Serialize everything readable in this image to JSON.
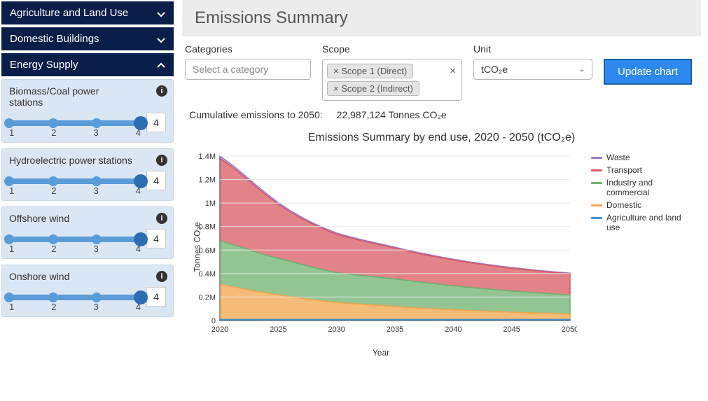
{
  "sidebar": {
    "sections": [
      {
        "title": "Agriculture and Land Use",
        "expanded": false
      },
      {
        "title": "Domestic Buildings",
        "expanded": false
      },
      {
        "title": "Energy Supply",
        "expanded": true
      }
    ],
    "sliders": [
      {
        "label": "Biomass/Coal power stations",
        "value": "4",
        "ticks": [
          "1",
          "2",
          "3",
          "4"
        ]
      },
      {
        "label": "Hydroelectric power stations",
        "value": "4",
        "ticks": [
          "1",
          "2",
          "3",
          "4"
        ]
      },
      {
        "label": "Offshore wind",
        "value": "4",
        "ticks": [
          "1",
          "2",
          "3",
          "4"
        ]
      },
      {
        "label": "Onshore wind",
        "value": "4",
        "ticks": [
          "1",
          "2",
          "3",
          "4"
        ]
      }
    ]
  },
  "header": {
    "title": "Emissions Summary"
  },
  "filters": {
    "categories_label": "Categories",
    "categories_placeholder": "Select a category",
    "scope_label": "Scope",
    "scope_chips": [
      "Scope 1 (Direct)",
      "Scope 2 (Indirect)"
    ],
    "scope_clear": "×",
    "unit_label": "Unit",
    "unit_value": "tCO₂e",
    "update_label": "Update chart"
  },
  "cumulative": {
    "label": "Cumulative emissions to 2050:",
    "value": "22,987,124 Tonnes CO₂e"
  },
  "chart_title": "Emissions Summary by end use, 2020 - 2050 (tCO₂e)",
  "axes": {
    "y": "Tonnes CO₂e",
    "x": "Year"
  },
  "yticks": [
    "0",
    "0.2M",
    "0.4M",
    "0.6M",
    "0.8M",
    "1M",
    "1.2M",
    "1.4M"
  ],
  "xticks": [
    "2020",
    "2025",
    "2030",
    "2035",
    "2040",
    "2045",
    "2050"
  ],
  "legend": [
    {
      "name": "Waste",
      "color": "#9e7cc1"
    },
    {
      "name": "Transport",
      "color": "#d85a63"
    },
    {
      "name": "Industry and commercial",
      "color": "#6fb26f"
    },
    {
      "name": "Domestic",
      "color": "#f2a54a"
    },
    {
      "name": "Agriculture and land use",
      "color": "#4a90c7"
    }
  ],
  "chart_data": {
    "type": "area",
    "title": "Emissions Summary by end use, 2020 - 2050 (tCO₂e)",
    "xlabel": "Year",
    "ylabel": "Tonnes CO₂e",
    "ylim": [
      0,
      1400000
    ],
    "x": [
      2020,
      2021,
      2022,
      2023,
      2024,
      2025,
      2026,
      2027,
      2028,
      2029,
      2030,
      2031,
      2032,
      2033,
      2034,
      2035,
      2036,
      2037,
      2038,
      2039,
      2040,
      2041,
      2042,
      2043,
      2044,
      2045,
      2046,
      2047,
      2048,
      2049,
      2050
    ],
    "series": [
      {
        "name": "Agriculture and land use",
        "color": "#4a90c7",
        "values": [
          10000,
          10000,
          10000,
          10000,
          10000,
          10000,
          10000,
          10000,
          10000,
          10000,
          10000,
          10000,
          10000,
          10000,
          10000,
          10000,
          10000,
          10000,
          10000,
          10000,
          10000,
          10000,
          10000,
          10000,
          10000,
          10000,
          10000,
          10000,
          10000,
          10000,
          10000
        ]
      },
      {
        "name": "Domestic",
        "color": "#f2a54a",
        "values": [
          300000,
          280000,
          260000,
          240000,
          225000,
          210000,
          195000,
          180000,
          167000,
          155000,
          145000,
          137000,
          130000,
          123000,
          117000,
          110000,
          103000,
          97000,
          92000,
          87000,
          82000,
          77000,
          73000,
          69000,
          65000,
          61000,
          58000,
          55000,
          52000,
          49000,
          46000
        ]
      },
      {
        "name": "Industry and commercial",
        "color": "#6fb26f",
        "values": [
          370000,
          360000,
          350000,
          335000,
          320000,
          310000,
          300000,
          288000,
          276000,
          264000,
          252000,
          248000,
          245000,
          242000,
          238000,
          234000,
          228000,
          222000,
          216000,
          210000,
          204000,
          199000,
          194000,
          189000,
          184000,
          180000,
          176000,
          172000,
          168000,
          165000,
          162000
        ]
      },
      {
        "name": "Transport",
        "color": "#d85a63",
        "values": [
          700000,
          660000,
          610000,
          560000,
          510000,
          460000,
          420000,
          390000,
          365000,
          345000,
          328000,
          312000,
          298000,
          285000,
          273000,
          262000,
          252000,
          242000,
          234000,
          226000,
          219000,
          213000,
          207000,
          202000,
          197000,
          193000,
          190000,
          187000,
          184000,
          182000,
          180000
        ]
      },
      {
        "name": "Waste",
        "color": "#9e7cc1",
        "values": [
          20000,
          19000,
          18000,
          17000,
          15000,
          14000,
          13000,
          12000,
          11000,
          11000,
          10000,
          10000,
          9000,
          9000,
          9000,
          8000,
          8000,
          8000,
          8000,
          7000,
          7000,
          7000,
          7000,
          7000,
          7000,
          7000,
          7000,
          6000,
          6000,
          6000,
          6000
        ]
      }
    ]
  }
}
